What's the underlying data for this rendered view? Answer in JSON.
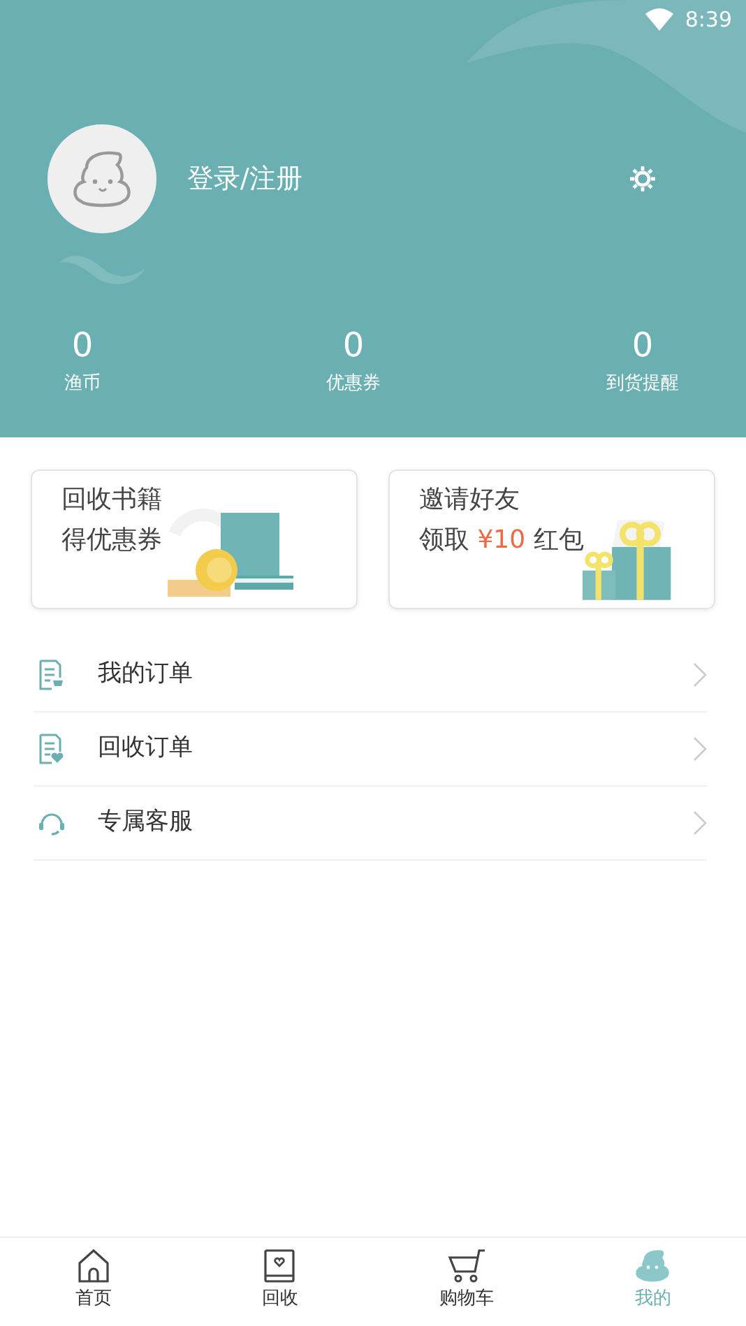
{
  "status_bar": {
    "time": "8:39"
  },
  "profile": {
    "login_label": "登录/注册"
  },
  "stats": [
    {
      "value": "0",
      "label": "渔币"
    },
    {
      "value": "0",
      "label": "优惠券"
    },
    {
      "value": "0",
      "label": "到货提醒"
    }
  ],
  "promos": [
    {
      "kind": "recycle",
      "line_1": "回收书籍",
      "line_2": "得优惠券"
    },
    {
      "kind": "invite",
      "line_1": "邀请好友",
      "line_2_prefix": "领取",
      "line_2_highlight": "¥10",
      "line_2_suffix": "红包"
    }
  ],
  "menu": [
    {
      "kind": "orders",
      "label": "我的订单"
    },
    {
      "kind": "recycle-orders",
      "label": "回收订单"
    },
    {
      "kind": "service",
      "label": "专属客服"
    }
  ],
  "tabs": [
    {
      "kind": "home",
      "label": "首页",
      "selected": false
    },
    {
      "kind": "recycle",
      "label": "回收",
      "selected": false
    },
    {
      "kind": "cart",
      "label": "购物车",
      "selected": false
    },
    {
      "kind": "mine",
      "label": "我的",
      "selected": true
    }
  ]
}
